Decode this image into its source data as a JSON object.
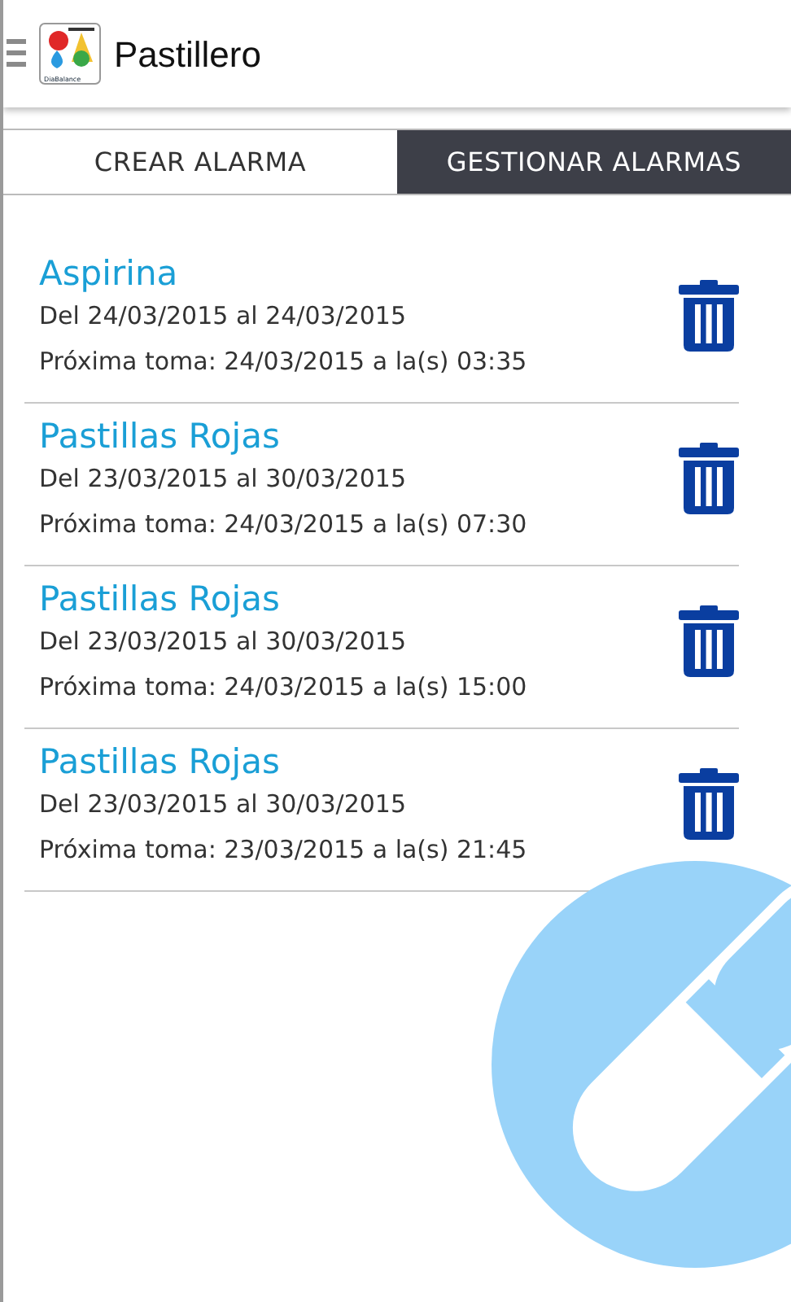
{
  "app_bar": {
    "title": "Pastillero",
    "logo_text": "DiaBalance"
  },
  "tabs": [
    {
      "label": "CREAR ALARMA",
      "selected": false
    },
    {
      "label": "GESTIONAR ALARMAS",
      "selected": true
    }
  ],
  "alarms": [
    {
      "name": "Aspirina",
      "range": "Del 24/03/2015 al 24/03/2015",
      "next": "Próxima toma: 24/03/2015 a la(s) 03:35"
    },
    {
      "name": "Pastillas Rojas",
      "range": "Del 23/03/2015 al 30/03/2015",
      "next": "Próxima toma: 24/03/2015 a la(s) 07:30"
    },
    {
      "name": "Pastillas Rojas",
      "range": "Del 23/03/2015 al 30/03/2015",
      "next": "Próxima toma: 24/03/2015 a la(s) 15:00"
    },
    {
      "name": "Pastillas Rojas",
      "range": "Del 23/03/2015 al 30/03/2015",
      "next": "Próxima toma: 23/03/2015 a la(s) 21:45"
    }
  ]
}
